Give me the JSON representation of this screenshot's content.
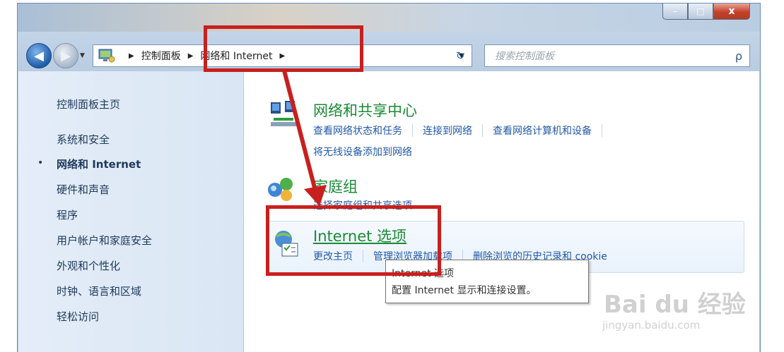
{
  "window": {
    "caption_buttons": {
      "minimize": "–",
      "maximize": "□",
      "close": "x"
    }
  },
  "nav": {
    "back_icon": "back-arrow-icon",
    "forward_icon": "forward-arrow-icon",
    "address": {
      "crumb1": "控制面板",
      "crumb2": "网络和 Internet",
      "sep": "▶",
      "dropdown": "▼"
    },
    "refresh": "↻",
    "search_placeholder": "搜索控制面板",
    "search_icon": "ρ"
  },
  "sidebar": {
    "items": [
      {
        "label": "控制面板主页"
      },
      {
        "label": "系统和安全"
      },
      {
        "label": "网络和 Internet",
        "active": true
      },
      {
        "label": "硬件和声音"
      },
      {
        "label": "程序"
      },
      {
        "label": "用户帐户和家庭安全"
      },
      {
        "label": "外观和个性化"
      },
      {
        "label": "时钟、语言和区域"
      },
      {
        "label": "轻松访问"
      }
    ],
    "bullet": "•"
  },
  "categories": [
    {
      "title": "网络和共享中心",
      "links": [
        "查看网络状态和任务",
        "连接到网络",
        "查看网络计算机和设备",
        "将无线设备添加到网络"
      ]
    },
    {
      "title": "家庭组",
      "links": [
        "选择家庭组和共享选项"
      ]
    },
    {
      "title": "Internet 选项",
      "links": [
        "更改主页",
        "管理浏览器加载项",
        "删除浏览的历史记录和 cookie"
      ]
    }
  ],
  "tooltip": {
    "line1": "Internet 选项",
    "line2": "配置 Internet 显示和连接设置。"
  },
  "watermark": {
    "brand": "Bai du 经验",
    "url": "jingyan.baidu.com"
  },
  "colors": {
    "annotation_red": "#c8201e",
    "link_blue": "#2159a8",
    "title_green": "#1b8a36"
  }
}
